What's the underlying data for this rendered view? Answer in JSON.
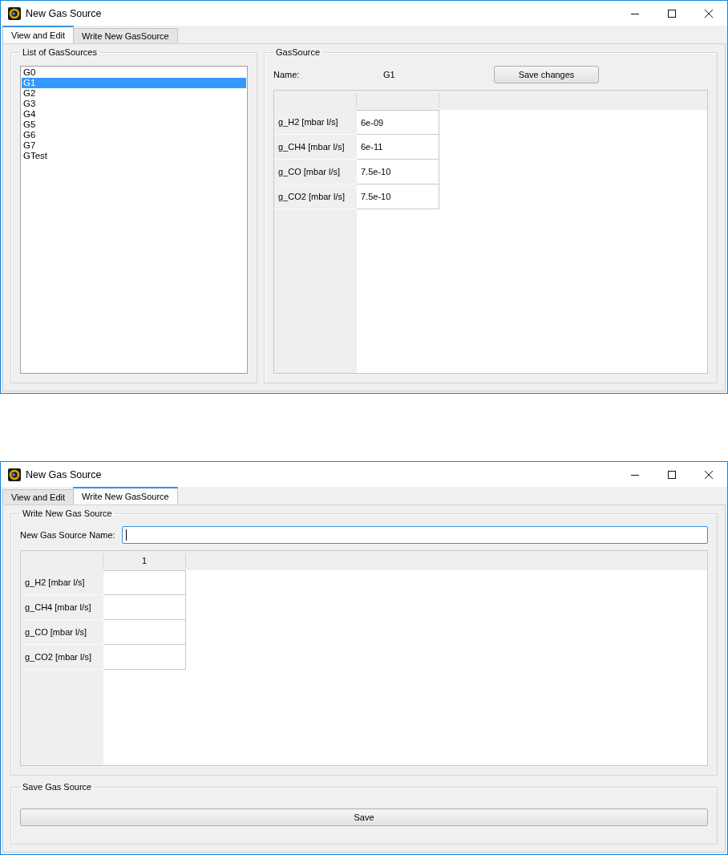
{
  "windows": [
    {
      "kind": "view",
      "title": "New Gas Source",
      "tabs": [
        {
          "label": "View and Edit",
          "selected": true
        },
        {
          "label": "Write New GasSource",
          "selected": false
        }
      ],
      "list_group": {
        "title": "List of GasSources",
        "items": [
          {
            "label": "G0",
            "selected": false
          },
          {
            "label": "G1",
            "selected": true
          },
          {
            "label": "G2",
            "selected": false
          },
          {
            "label": "G3",
            "selected": false
          },
          {
            "label": "G4",
            "selected": false
          },
          {
            "label": "G5",
            "selected": false
          },
          {
            "label": "G6",
            "selected": false
          },
          {
            "label": "G7",
            "selected": false
          },
          {
            "label": "GTest",
            "selected": false
          }
        ]
      },
      "detail_group": {
        "title": "GasSource",
        "name_label": "Name:",
        "name_value": "G1",
        "button": "Save changes",
        "table": {
          "rows": [
            {
              "header": "g_H2 [mbar l/s]",
              "value": "6e-09"
            },
            {
              "header": "g_CH4 [mbar l/s]",
              "value": "6e-11"
            },
            {
              "header": "g_CO [mbar l/s]",
              "value": "7.5e-10"
            },
            {
              "header": "g_CO2 [mbar l/s]",
              "value": "7.5e-10"
            }
          ]
        }
      }
    },
    {
      "kind": "write",
      "title": "New Gas Source",
      "tabs": [
        {
          "label": "View and Edit",
          "selected": false
        },
        {
          "label": "Write New GasSource",
          "selected": true
        }
      ],
      "write_group": {
        "title": "Write New Gas Source",
        "field_label": "New Gas Source Name:",
        "field_focused": true,
        "table": {
          "columns": [
            {
              "label": "1"
            }
          ],
          "rows": [
            {
              "header": "g_H2 [mbar l/s]"
            },
            {
              "header": "g_CH4 [mbar l/s]"
            },
            {
              "header": "g_CO [mbar l/s]"
            },
            {
              "header": "g_CO2 [mbar l/s]"
            }
          ]
        }
      },
      "save_group": {
        "title": "Save Gas Source",
        "button": "Save"
      }
    }
  ]
}
